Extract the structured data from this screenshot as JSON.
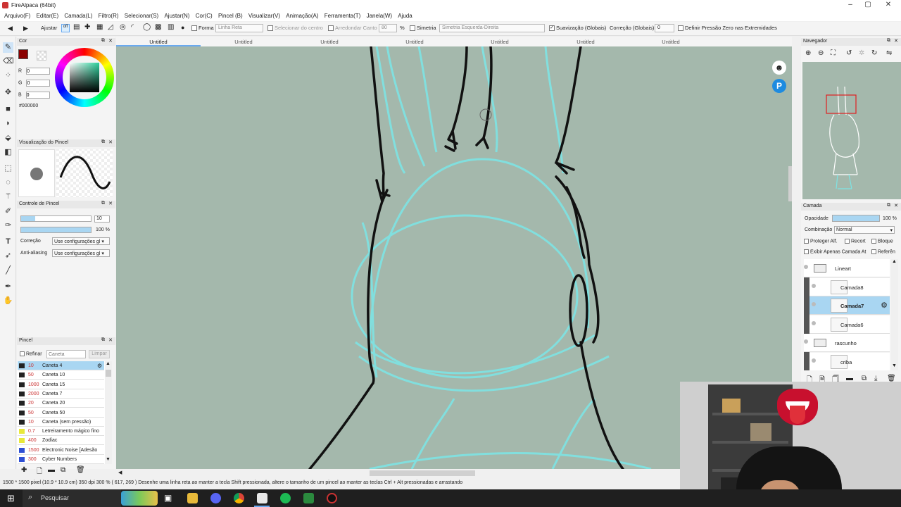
{
  "app": {
    "title": "FireAlpaca (64bit)"
  },
  "menu": [
    "Arquivo(F)",
    "Editar(E)",
    "Camada(L)",
    "Filtro(R)",
    "Selecionar(S)",
    "Ajustar(N)",
    "Cor(C)",
    "Pincel (B)",
    "Visualizar(V)",
    "Animação(A)",
    "Ferramenta(T)",
    "Janela(W)",
    "Ajuda"
  ],
  "toolbar": {
    "adjust": "Ajustar",
    "off": "off",
    "shape": "Forma",
    "shape_value": "Linha Reta",
    "select_center": "Selecionar do centro",
    "round_corner": "Arredondar Canto",
    "round_value": "80",
    "percent": "%",
    "symmetry": "Simetria",
    "symmetry_value": "Simetria Esquerda-Direita",
    "smoothing": "Suavização (Globais)",
    "correction": "Correção (Globais)",
    "correction_value": "0",
    "zero_pressure": "Definir Pressão Zero nas Extremidades"
  },
  "tabs": [
    "Untitled",
    "Untitled",
    "Untitled",
    "Untitled",
    "Untitled",
    "Untitled",
    "Untitled"
  ],
  "color_panel": {
    "title": "Cor",
    "r_label": "R",
    "r": "0",
    "g_label": "G",
    "g": "0",
    "b_label": "B",
    "b": "0",
    "hex": "#000000",
    "fg_color": "#8b0000"
  },
  "brush_preview": {
    "title": "Visualização do Pincel"
  },
  "brush_control": {
    "title": "Controle de Pincel",
    "size": "10",
    "opacity": "100 %",
    "correction_label": "Correção",
    "correction_value": "Use configurações gl",
    "antialias_label": "Anti-aliasing",
    "antialias_value": "Use configurações gl"
  },
  "brush_list": {
    "title": "Pincel",
    "refine": "Refinar",
    "search_placeholder": "Caneta",
    "clear": "Limpar",
    "items": [
      {
        "color": "#222222",
        "size": "10",
        "name": "Caneta 4"
      },
      {
        "color": "#222222",
        "size": "50",
        "name": "Caneta 10"
      },
      {
        "color": "#222222",
        "size": "1000",
        "name": "Caneta 15"
      },
      {
        "color": "#222222",
        "size": "2000",
        "name": "Caneta 7"
      },
      {
        "color": "#222222",
        "size": "20",
        "name": "Caneta 20"
      },
      {
        "color": "#222222",
        "size": "50",
        "name": "Caneta 50"
      },
      {
        "color": "#222222",
        "size": "10",
        "name": "Caneta (sem pressão)"
      },
      {
        "color": "#e8e83a",
        "size": "0.7",
        "name": "Letreiramento mágico fino"
      },
      {
        "color": "#e8e83a",
        "size": "400",
        "name": "Zodíac"
      },
      {
        "color": "#2e4fd4",
        "size": "1500",
        "name": "Electronic Noise [Adesão"
      },
      {
        "color": "#2e4fd4",
        "size": "300",
        "name": "Cyber Numbers"
      }
    ]
  },
  "navigator": {
    "title": "Navegador"
  },
  "layers": {
    "title": "Camada",
    "opacity_label": "Opacidade",
    "opacity_value": "100 %",
    "blend_label": "Combinação",
    "blend_value": "Normal",
    "protect_alpha": "Proteger Alf.",
    "clip": "Recort",
    "lock": "Bloque",
    "show_ai": "Exibir Apenas Camada At",
    "reference": "Referên",
    "items": [
      {
        "name": "Lineart",
        "type": "folder"
      },
      {
        "name": "Camada8",
        "type": "layer"
      },
      {
        "name": "Camada7",
        "type": "layer"
      },
      {
        "name": "Camada6",
        "type": "layer"
      },
      {
        "name": "rascunho",
        "type": "folder"
      },
      {
        "name": "criba",
        "type": "layer"
      }
    ]
  },
  "status": {
    "text": "1500 * 1500 pixel   (10.9 * 10.9 cm)   350 dpi   300 %   ( 617, 269 )   Desenhe uma linha reta ao manter a tecla Shift pressionada, altere o tamanho de um pincel ao manter as teclas Ctrl + Alt pressionadas e arrastando"
  },
  "taskbar": {
    "search": "Pesquisar"
  }
}
